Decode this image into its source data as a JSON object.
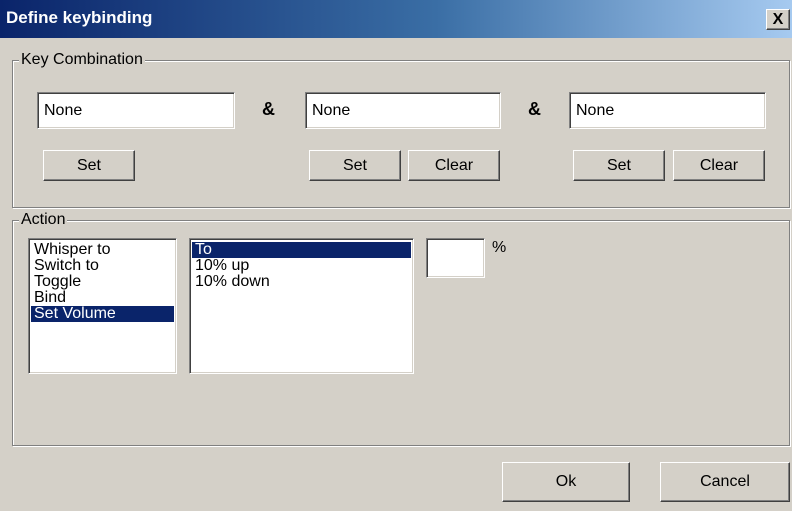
{
  "window": {
    "title": "Define keybinding",
    "close_label": "X"
  },
  "key_combination": {
    "legend": "Key Combination",
    "key1_value": "None",
    "key2_value": "None",
    "key3_value": "None",
    "separator": "&",
    "set_label": "Set",
    "clear_label": "Clear"
  },
  "action": {
    "legend": "Action",
    "actions": [
      "Whisper to",
      "Switch to",
      "Toggle",
      "Bind",
      "Set Volume"
    ],
    "selected_action": "Set Volume",
    "volume_modes": [
      "To",
      "10% up",
      "10% down"
    ],
    "selected_mode": "To",
    "percent_value": "",
    "percent_symbol": "%"
  },
  "footer": {
    "ok_label": "Ok",
    "cancel_label": "Cancel"
  },
  "colors": {
    "selection": "#0a246a",
    "face": "#d4d0c8",
    "title_start": "#0a246a",
    "title_end": "#a6caf0"
  }
}
